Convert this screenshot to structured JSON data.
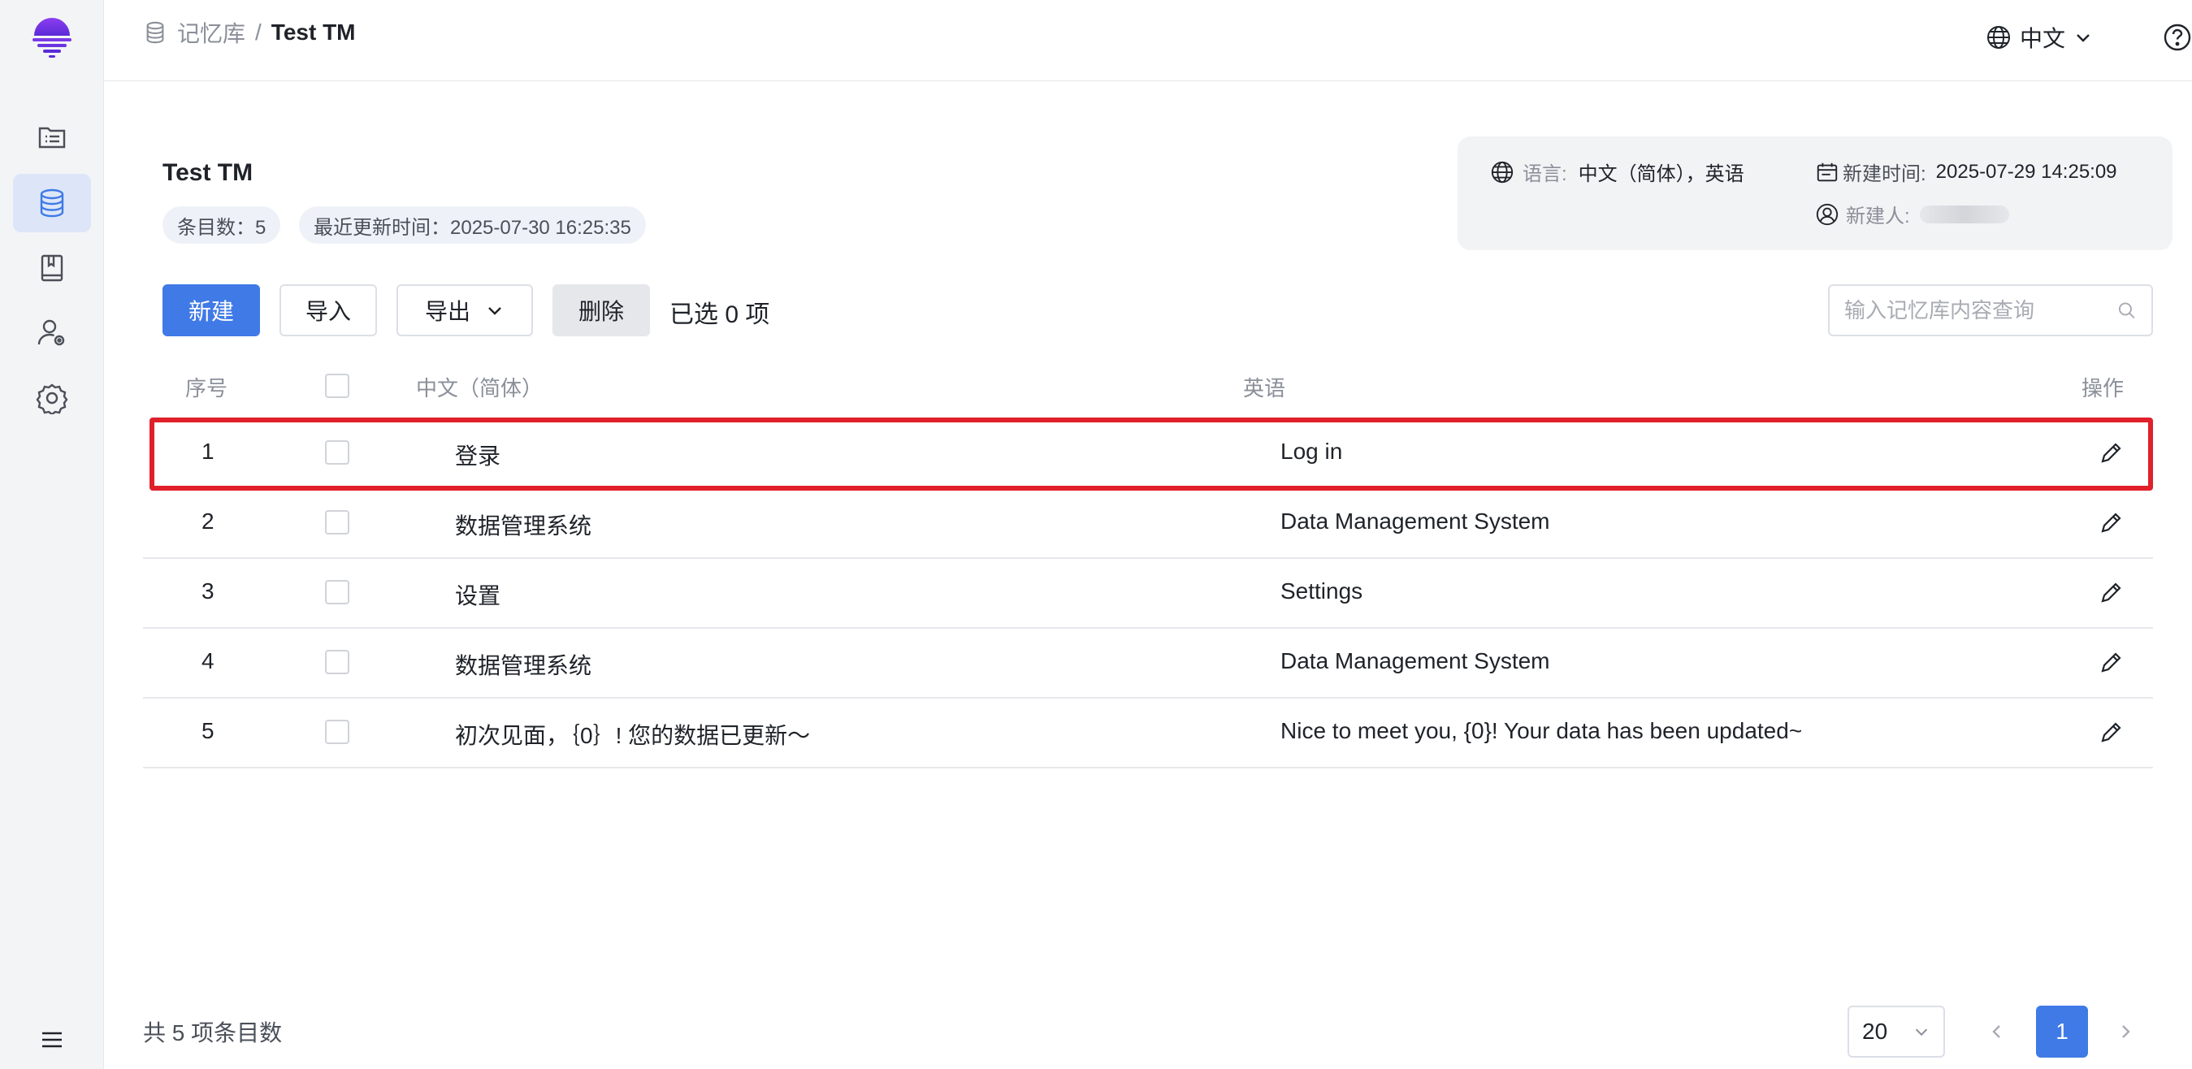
{
  "header": {
    "breadcrumb_root": "记忆库",
    "breadcrumb_sep": "/",
    "breadcrumb_current": "Test TM",
    "language": "中文"
  },
  "tm": {
    "title": "Test TM",
    "count_tag": "条目数：5",
    "updated_tag": "最近更新时间：2025-07-30 16:25:35"
  },
  "info": {
    "lang_label": "语言:",
    "lang_value": "中文（简体），英语",
    "created_label": "新建时间:",
    "created_value": "2025-07-29 14:25:09",
    "creator_label": "新建人:"
  },
  "toolbar": {
    "new_label": "新建",
    "import_label": "导入",
    "export_label": "导出",
    "delete_label": "删除",
    "selected_text": "已选 0 项",
    "search_placeholder": "输入记忆库内容查询"
  },
  "table": {
    "headers": {
      "index": "序号",
      "source": "中文（简体）",
      "target": "英语",
      "action": "操作"
    },
    "rows": [
      {
        "index": "1",
        "source": "登录",
        "target": "Log in"
      },
      {
        "index": "2",
        "source": "数据管理系统",
        "target": "Data Management System"
      },
      {
        "index": "3",
        "source": "设置",
        "target": "Settings"
      },
      {
        "index": "4",
        "source": "数据管理系统",
        "target": "Data Management System"
      },
      {
        "index": "5",
        "source": "初次见面，｛0｝! 您的数据已更新～",
        "target": "Nice to meet you, {0}! Your data has been updated~"
      }
    ]
  },
  "footer": {
    "total": "共 5 项条目数",
    "page_size": "20",
    "current_page": "1"
  },
  "colors": {
    "primary": "#3f7ae6",
    "highlight": "#e0202a",
    "sidebar_active": "#dde6f8"
  }
}
